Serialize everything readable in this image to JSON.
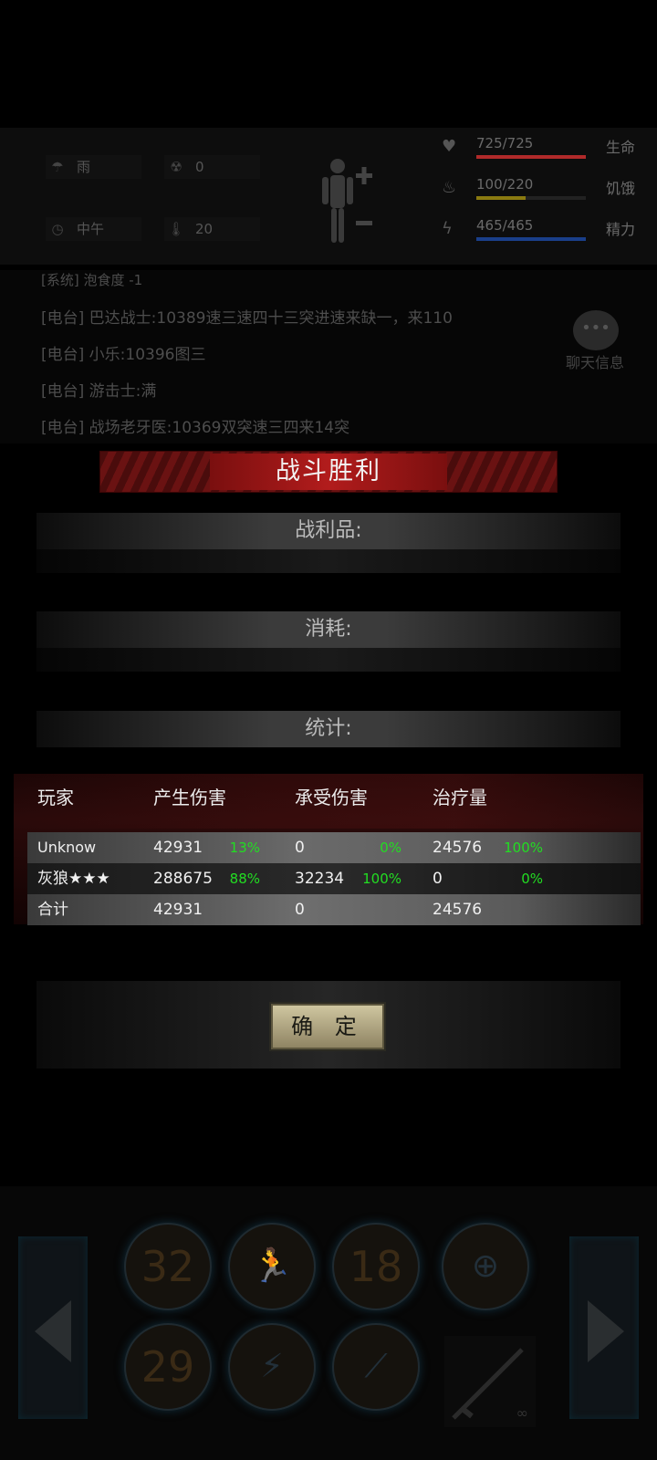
{
  "hud": {
    "weather": "雨",
    "radiation": "0",
    "time_of_day": "中午",
    "temperature": "20",
    "stats": [
      {
        "icon": "heart-icon",
        "value": "725/725",
        "label": "生命",
        "fraction": 1.0,
        "color": "#b02a2a"
      },
      {
        "icon": "stomach-icon",
        "value": "100/220",
        "label": "饥饿",
        "fraction": 0.45,
        "color": "#8a7a10"
      },
      {
        "icon": "energy-icon",
        "value": "465/465",
        "label": "精力",
        "fraction": 1.0,
        "color": "#1a3f8a"
      }
    ]
  },
  "chat": {
    "lines": [
      "[系统] 泡食度 -1",
      "[电台] 巴达战士:10389速三速四十三突进速来缺一，来110",
      "[电台] 小乐:10396图三",
      "[电台] 游击士:满",
      "[电台] 战场老牙医:10369双突速三四来14突"
    ],
    "button_label": "聊天信息"
  },
  "dialog": {
    "title": "战斗胜利",
    "loot_label": "战利品:",
    "consume_label": "消耗:",
    "stats_label": "统计:",
    "table": {
      "headers": [
        "玩家",
        "产生伤害",
        "承受伤害",
        "治疗量"
      ],
      "rows": [
        {
          "player": "Unknow",
          "dmg": "42931",
          "dmg_pct": "13%",
          "taken": "0",
          "taken_pct": "0%",
          "heal": "24576",
          "heal_pct": "100%"
        },
        {
          "player": "灰狼★★★",
          "dmg": "288675",
          "dmg_pct": "88%",
          "taken": "32234",
          "taken_pct": "100%",
          "heal": "0",
          "heal_pct": "0%"
        }
      ],
      "total": {
        "player": "合计",
        "dmg": "42931",
        "taken": "0",
        "heal": "24576"
      }
    },
    "confirm_label": "确 定"
  },
  "skills": {
    "row1": [
      {
        "name": "cooldown-skill-1",
        "value": "32"
      },
      {
        "name": "sprint-skill",
        "value": ""
      },
      {
        "name": "cooldown-skill-2",
        "value": "18"
      },
      {
        "name": "aim-skill",
        "value": ""
      }
    ],
    "row2": [
      {
        "name": "cooldown-skill-3",
        "value": "29"
      },
      {
        "name": "dodge-skill",
        "value": ""
      },
      {
        "name": "slash-skill",
        "value": ""
      }
    ],
    "weapon_ammo": "∞"
  }
}
